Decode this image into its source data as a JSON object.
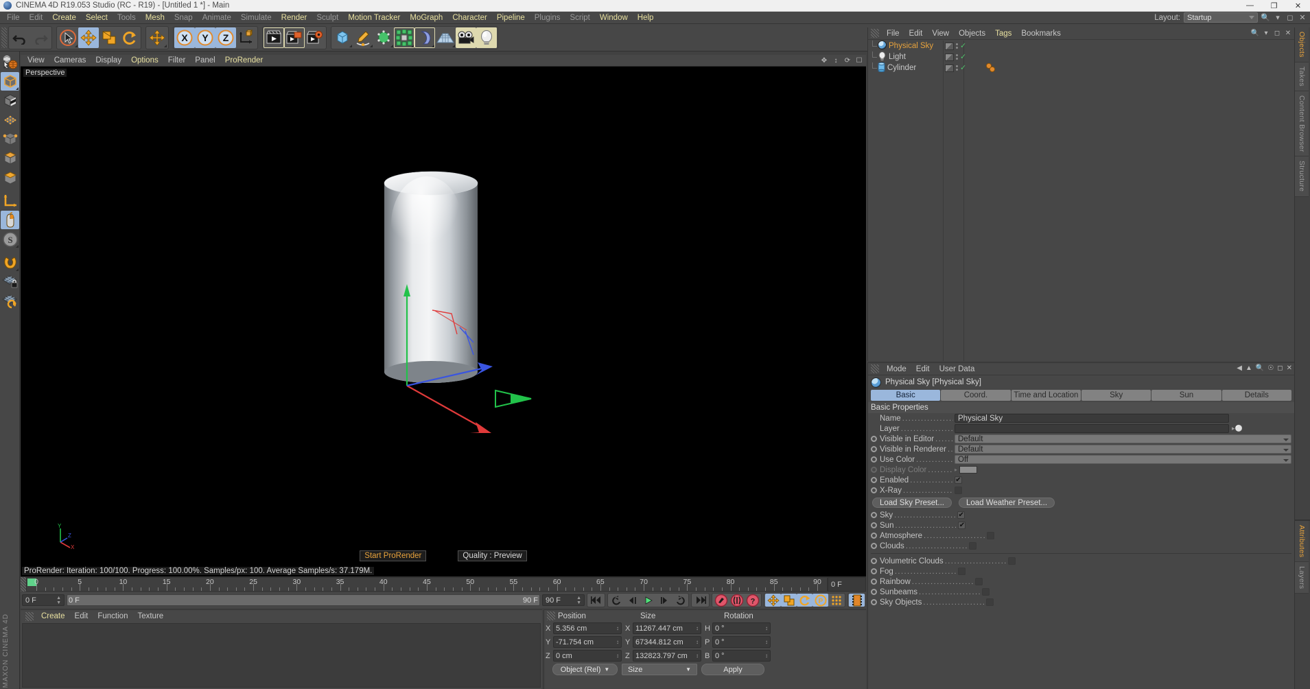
{
  "window": {
    "title": "CINEMA 4D R19.053 Studio (RC - R19) - [Untitled 1 *] - Main",
    "minimize": "—",
    "maximize": "❐",
    "close": "✕"
  },
  "menubar": {
    "items": [
      {
        "label": "File",
        "highlight": false
      },
      {
        "label": "Edit",
        "highlight": false
      },
      {
        "label": "Create",
        "highlight": true
      },
      {
        "label": "Select",
        "highlight": true
      },
      {
        "label": "Tools",
        "highlight": false
      },
      {
        "label": "Mesh",
        "highlight": true
      },
      {
        "label": "Snap",
        "highlight": false
      },
      {
        "label": "Animate",
        "highlight": false
      },
      {
        "label": "Simulate",
        "highlight": false
      },
      {
        "label": "Render",
        "highlight": true
      },
      {
        "label": "Sculpt",
        "highlight": false
      },
      {
        "label": "Motion Tracker",
        "highlight": true
      },
      {
        "label": "MoGraph",
        "highlight": true
      },
      {
        "label": "Character",
        "highlight": true
      },
      {
        "label": "Pipeline",
        "highlight": true
      },
      {
        "label": "Plugins",
        "highlight": false
      },
      {
        "label": "Script",
        "highlight": false
      },
      {
        "label": "Window",
        "highlight": true
      },
      {
        "label": "Help",
        "highlight": true
      }
    ],
    "layout_label": "Layout:",
    "layout_value": "Startup"
  },
  "toolbar": {
    "undo": "undo-icon",
    "redo": "redo-icon",
    "live_selection": "live-selection-icon",
    "move": "move-icon",
    "scale": "scale-icon",
    "rotate": "rotate-icon",
    "move_active": "move-active-icon",
    "axis_x": "X",
    "axis_y": "Y",
    "axis_z": "Z",
    "world_axis": "world-coordinate-icon",
    "render_view": "render-view-icon",
    "render_picture_viewer": "render-picture-viewer-icon",
    "render_settings": "render-settings-icon",
    "cube": "cube-primitive-icon",
    "spline": "spline-pen-icon",
    "nurbs": "generator-nurbs-icon",
    "array": "mograph-array-icon",
    "bend": "deformer-bend-icon",
    "floor": "floor-scene-icon",
    "camera": "camera-icon",
    "light": "light-icon"
  },
  "left_toolbar": {
    "items": [
      {
        "name": "make-editable-icon",
        "active": false
      },
      {
        "name": "model-mode-icon",
        "active": true
      },
      {
        "name": "texture-mode-icon",
        "active": false
      },
      {
        "name": "points-mode-icon",
        "active": false
      },
      {
        "name": "edges-mode-icon",
        "active": false
      },
      {
        "name": "polygons-mode-icon",
        "active": false
      },
      {
        "name": "object-axis-icon",
        "active": false
      },
      {
        "name": "viewport-solo-icon",
        "active": false
      },
      {
        "name": "enable-axis-icon",
        "active": true
      },
      {
        "name": "snap-icon",
        "active": false
      },
      {
        "name": "quantize-icon",
        "active": false
      },
      {
        "name": "workplane-lock-icon",
        "active": false
      },
      {
        "name": "workplane-rotate-icon",
        "active": false
      }
    ],
    "brand": "MAXON CINEMA 4D"
  },
  "viewport": {
    "menu": [
      {
        "label": "View",
        "highlight": false
      },
      {
        "label": "Cameras",
        "highlight": false
      },
      {
        "label": "Display",
        "highlight": false
      },
      {
        "label": "Options",
        "highlight": true
      },
      {
        "label": "Filter",
        "highlight": false
      },
      {
        "label": "Panel",
        "highlight": false
      },
      {
        "label": "ProRender",
        "highlight": true
      }
    ],
    "label": "Perspective",
    "start_prorender": "Start ProRender",
    "quality": "Quality : Preview",
    "status": "ProRender: Iteration: 100/100. Progress: 100.00%. Samples/px: 100. Average Samples/s: 37.179M.",
    "axis_x": "X",
    "axis_y": "Y",
    "axis_z": "Z"
  },
  "timeline": {
    "ticks": [
      0,
      5,
      10,
      15,
      20,
      25,
      30,
      35,
      40,
      45,
      50,
      55,
      60,
      65,
      70,
      75,
      80,
      85,
      90
    ],
    "min": 0,
    "max": 90,
    "current_frame_field": "0 F",
    "end_field": "0 F",
    "range_start": "0 F",
    "range_end": "90 F",
    "doc_end": "90 F"
  },
  "playbar": {
    "buttons": [
      {
        "name": "go-to-start-button",
        "glyph": "⏮"
      },
      {
        "name": "previous-key-button",
        "glyph": "↶"
      },
      {
        "name": "step-back-button",
        "glyph": "◁"
      },
      {
        "name": "play-button",
        "glyph": "▶"
      },
      {
        "name": "step-forward-button",
        "glyph": "▷"
      },
      {
        "name": "next-key-button",
        "glyph": "↷"
      },
      {
        "name": "go-to-end-button",
        "glyph": "⏭"
      },
      {
        "name": "record-active-objects-button",
        "glyph": "●"
      },
      {
        "name": "autokeying-button",
        "glyph": "○"
      },
      {
        "name": "keyframe-selection-button",
        "glyph": "?"
      },
      {
        "name": "position-key-button",
        "glyph": "✥"
      },
      {
        "name": "scale-key-button",
        "glyph": "◰"
      },
      {
        "name": "rotation-key-button",
        "glyph": "↻"
      },
      {
        "name": "param-key-button",
        "glyph": "P"
      },
      {
        "name": "point-level-anim-button",
        "glyph": "⁘"
      },
      {
        "name": "timeline-button",
        "glyph": "☷"
      }
    ]
  },
  "material_manager": {
    "menu": [
      {
        "label": "Create",
        "highlight": true
      },
      {
        "label": "Edit",
        "highlight": false
      },
      {
        "label": "Function",
        "highlight": false
      },
      {
        "label": "Texture",
        "highlight": false
      }
    ]
  },
  "coordinates": {
    "headers": [
      "Position",
      "Size",
      "Rotation"
    ],
    "rows": [
      {
        "pos_axis": "X",
        "pos_value": "5.356 cm",
        "size_axis": "X",
        "size_value": "11267.447 cm",
        "rot_axis": "H",
        "rot_value": "0 °"
      },
      {
        "pos_axis": "Y",
        "pos_value": "-71.754 cm",
        "size_axis": "Y",
        "size_value": "67344.812 cm",
        "rot_axis": "P",
        "rot_value": "0 °"
      },
      {
        "pos_axis": "Z",
        "pos_value": "0 cm",
        "size_axis": "Z",
        "size_value": "132823.797 cm",
        "rot_axis": "B",
        "rot_value": "0 °"
      }
    ],
    "mode_dropdown": "Object (Rel)",
    "size_dropdown": "Size",
    "apply_button": "Apply"
  },
  "object_manager": {
    "menu": [
      {
        "label": "File",
        "highlight": false
      },
      {
        "label": "Edit",
        "highlight": false
      },
      {
        "label": "View",
        "highlight": false
      },
      {
        "label": "Objects",
        "highlight": false
      },
      {
        "label": "Tags",
        "highlight": true
      },
      {
        "label": "Bookmarks",
        "highlight": false
      }
    ],
    "objects": [
      {
        "name": "Physical Sky",
        "icon": "physical-sky-icon",
        "selected": true,
        "has_material": false
      },
      {
        "name": "Light",
        "icon": "light-object-icon",
        "selected": false,
        "has_material": false
      },
      {
        "name": "Cylinder",
        "icon": "cylinder-object-icon",
        "selected": false,
        "has_material": true
      }
    ]
  },
  "attribute_manager": {
    "menu": [
      {
        "label": "Mode",
        "highlight": false
      },
      {
        "label": "Edit",
        "highlight": false
      },
      {
        "label": "User Data",
        "highlight": false
      }
    ],
    "header": "Physical Sky [Physical Sky]",
    "tabs": [
      {
        "label": "Basic",
        "active": true
      },
      {
        "label": "Coord.",
        "active": false
      },
      {
        "label": "Time and Location",
        "active": false
      },
      {
        "label": "Sky",
        "active": false
      },
      {
        "label": "Sun",
        "active": false
      },
      {
        "label": "Details",
        "active": false
      }
    ],
    "section_title": "Basic Properties",
    "properties": [
      {
        "label": "Name",
        "kind": "text",
        "value": "Physical Sky",
        "radio": false,
        "dim": false
      },
      {
        "label": "Layer",
        "kind": "text",
        "value": "",
        "radio": false,
        "dim": false
      },
      {
        "label": "Visible in Editor",
        "kind": "dropdown",
        "value": "Default",
        "radio": true,
        "dim": false
      },
      {
        "label": "Visible in Renderer",
        "kind": "dropdown",
        "value": "Default",
        "radio": true,
        "dim": false
      },
      {
        "label": "Use Color",
        "kind": "dropdown",
        "value": "Off",
        "radio": true,
        "dim": false
      },
      {
        "label": "Display Color",
        "kind": "swatch",
        "value": "",
        "radio": true,
        "dim": true
      },
      {
        "label": "Enabled",
        "kind": "check",
        "value": true,
        "radio": true,
        "dim": false
      },
      {
        "label": "X-Ray",
        "kind": "check",
        "value": false,
        "radio": true,
        "dim": false
      }
    ],
    "preset_buttons": [
      {
        "label": "Load Sky Preset..."
      },
      {
        "label": "Load Weather Preset..."
      }
    ],
    "toggles_group_1": [
      {
        "label": "Sky",
        "value": true
      },
      {
        "label": "Sun",
        "value": true
      },
      {
        "label": "Atmosphere",
        "value": false
      },
      {
        "label": "Clouds",
        "value": false
      }
    ],
    "toggles_group_2": [
      {
        "label": "Volumetric Clouds",
        "value": false
      },
      {
        "label": "Fog",
        "value": false
      },
      {
        "label": "Rainbow",
        "value": false
      },
      {
        "label": "Sunbeams",
        "value": false
      },
      {
        "label": "Sky Objects",
        "value": false
      }
    ]
  },
  "right_tabs_top": [
    {
      "label": "Objects",
      "active": true
    },
    {
      "label": "Takes",
      "active": false
    },
    {
      "label": "Content Browser",
      "active": false
    },
    {
      "label": "Structure",
      "active": false
    }
  ],
  "right_tabs_bottom": [
    {
      "label": "Attributes",
      "active": true
    },
    {
      "label": "Layers",
      "active": false
    }
  ],
  "colors": {
    "accent_orange": "#e8a33d",
    "menu_yellow": "#e8e0a0",
    "selection_blue": "#9ab7dc",
    "check_green": "#4fc16a",
    "panel_bg": "#474747"
  }
}
